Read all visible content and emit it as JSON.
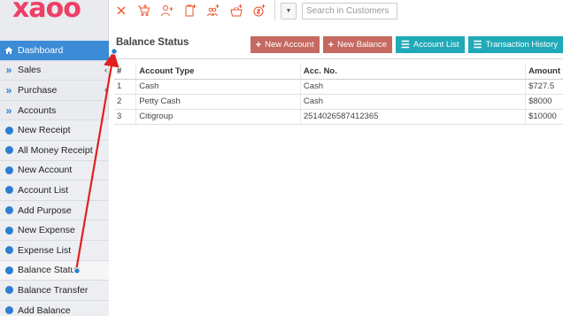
{
  "brand": {
    "logo_text": "xaoo"
  },
  "sidebar": {
    "items": [
      {
        "label": "Dashboard",
        "icon": "home-icon",
        "state": "active"
      },
      {
        "label": "Sales",
        "icon": "double-chevron-icon",
        "caret": "‹"
      },
      {
        "label": "Purchase",
        "icon": "double-chevron-icon",
        "caret": "‹"
      },
      {
        "label": "Accounts",
        "icon": "double-chevron-icon"
      },
      {
        "label": "New Receipt",
        "icon": "circle-arrow-icon"
      },
      {
        "label": "All Money Receipt",
        "icon": "circle-arrow-icon"
      },
      {
        "label": "New Account",
        "icon": "circle-arrow-icon"
      },
      {
        "label": "Account List",
        "icon": "circle-arrow-icon"
      },
      {
        "label": "Add Purpose",
        "icon": "circle-arrow-icon"
      },
      {
        "label": "New Expense",
        "icon": "circle-arrow-icon"
      },
      {
        "label": "Expense List",
        "icon": "circle-arrow-icon"
      },
      {
        "label": "Balance Status",
        "icon": "circle-arrow-icon",
        "state": "selected"
      },
      {
        "label": "Balance Transfer",
        "icon": "circle-arrow-icon"
      },
      {
        "label": "Add Balance",
        "icon": "circle-arrow-icon"
      }
    ]
  },
  "topbar": {
    "icons": [
      "close-icon",
      "cart-add-icon",
      "user-add-icon",
      "clipboard-add-icon",
      "users-add-icon",
      "basket-add-icon",
      "money-add-icon"
    ],
    "search": {
      "placeholder": "Search in Customers",
      "value": ""
    }
  },
  "panel": {
    "title": "Balance Status",
    "buttons": {
      "new_account": "New Account",
      "new_balance": "New Balance",
      "account_list": "Account List",
      "transaction_history": "Transaction History"
    },
    "table": {
      "headers": [
        "#",
        "Account Type",
        "Acc. No.",
        "Amount"
      ],
      "rows": [
        [
          "1",
          "Cash",
          "Cash",
          "$727.5"
        ],
        [
          "2",
          "Petty Cash",
          "Cash",
          "$8000"
        ],
        [
          "3",
          "Citigroup",
          "2514026587412365",
          "$10000"
        ]
      ]
    }
  },
  "colors": {
    "sidebar_bg": "#e9ebee",
    "active": "#3b8bd6",
    "button_red": "#c56961",
    "button_teal": "#20aab8",
    "logo": "#ee3f67",
    "annotation_arrow": "#e02020"
  }
}
